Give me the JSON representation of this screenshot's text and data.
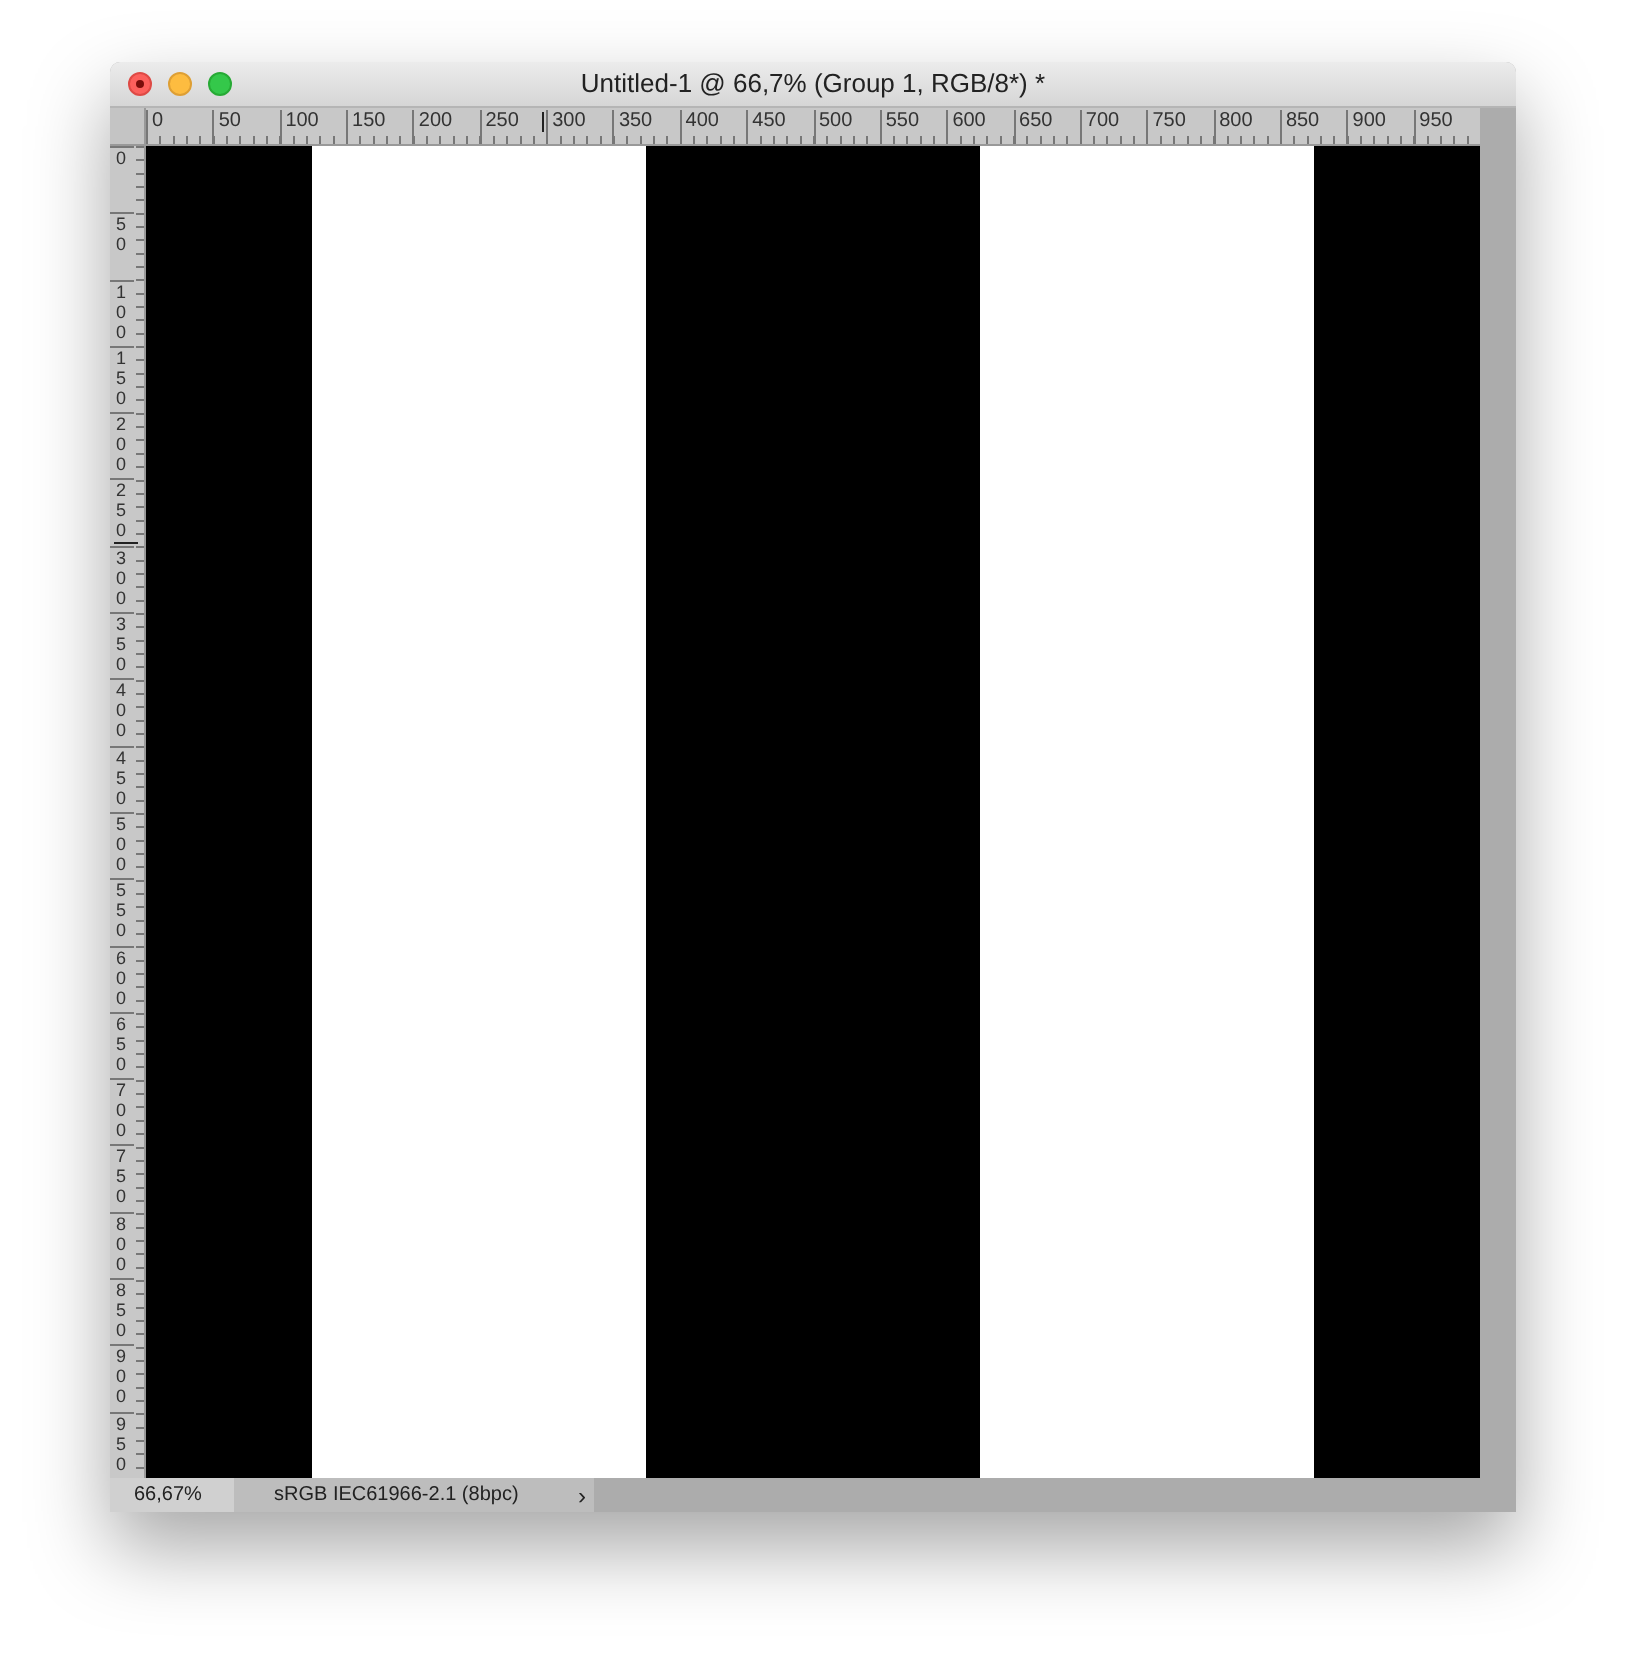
{
  "window": {
    "title": "Untitled-1 @ 66,7% (Group 1, RGB/8*) *"
  },
  "ruler_top": {
    "labels": [
      "0",
      "50",
      "100",
      "150",
      "200",
      "250",
      "300",
      "350",
      "400",
      "450",
      "500",
      "550",
      "600",
      "650",
      "700",
      "750",
      "800",
      "850",
      "900",
      "950"
    ]
  },
  "ruler_left": {
    "labels": [
      "0",
      "50",
      "100",
      "150",
      "200",
      "250",
      "300",
      "350",
      "400",
      "450",
      "500",
      "550",
      "600",
      "650",
      "700",
      "750",
      "800",
      "850",
      "900",
      "950"
    ]
  },
  "canvas": {
    "stripes": [
      {
        "color": "#000000"
      },
      {
        "color": "#ffffff"
      },
      {
        "color": "#000000"
      },
      {
        "color": "#ffffff"
      },
      {
        "color": "#000000"
      }
    ]
  },
  "status_bar": {
    "zoom": "66,67%",
    "profile": "sRGB IEC61966-2.1 (8bpc)",
    "arrow": "›"
  }
}
